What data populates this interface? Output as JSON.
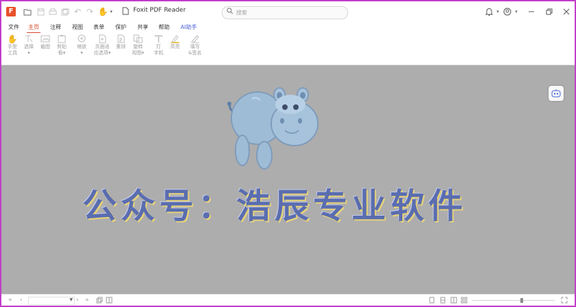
{
  "app": {
    "title": "Foxit PDF Reader",
    "brand_color": "#e8512a"
  },
  "search": {
    "placeholder": "搜索"
  },
  "menu": {
    "items": [
      "文件",
      "主页",
      "注释",
      "视图",
      "表单",
      "保护",
      "共享",
      "帮助",
      "AI助手"
    ],
    "active": "主页"
  },
  "ribbon": {
    "tools": [
      {
        "label": "手型",
        "label2": "工具",
        "icon": "hand-icon"
      },
      {
        "label": "选择",
        "label2": "▾",
        "icon": "text-select-icon"
      },
      {
        "label": "截图",
        "label2": "",
        "icon": "snapshot-icon"
      },
      {
        "label": "剪贴",
        "label2": "板▾",
        "icon": "clipboard-icon"
      },
      {
        "label": "缩放",
        "label2": "▾",
        "icon": "zoom-icon"
      },
      {
        "label": "页面适",
        "label2": "应选项▾",
        "icon": "fit-page-icon"
      },
      {
        "label": "重排",
        "label2": "",
        "icon": "reflow-icon"
      },
      {
        "label": "旋转",
        "label2": "视图▾",
        "icon": "rotate-icon"
      },
      {
        "label": "打",
        "label2": "字机",
        "icon": "typewriter-icon"
      },
      {
        "label": "高亮",
        "label2": "",
        "icon": "highlight-icon"
      },
      {
        "label": "填写",
        "label2": "&签名",
        "icon": "fill-sign-icon"
      }
    ]
  },
  "canvas": {
    "watermark_text": "公众号：浩辰专业软件"
  },
  "colors": {
    "canvas_bg": "#adadad",
    "border": "#c13dc9",
    "active_tab": "#d64828",
    "ai_tab": "#4a63d8"
  }
}
